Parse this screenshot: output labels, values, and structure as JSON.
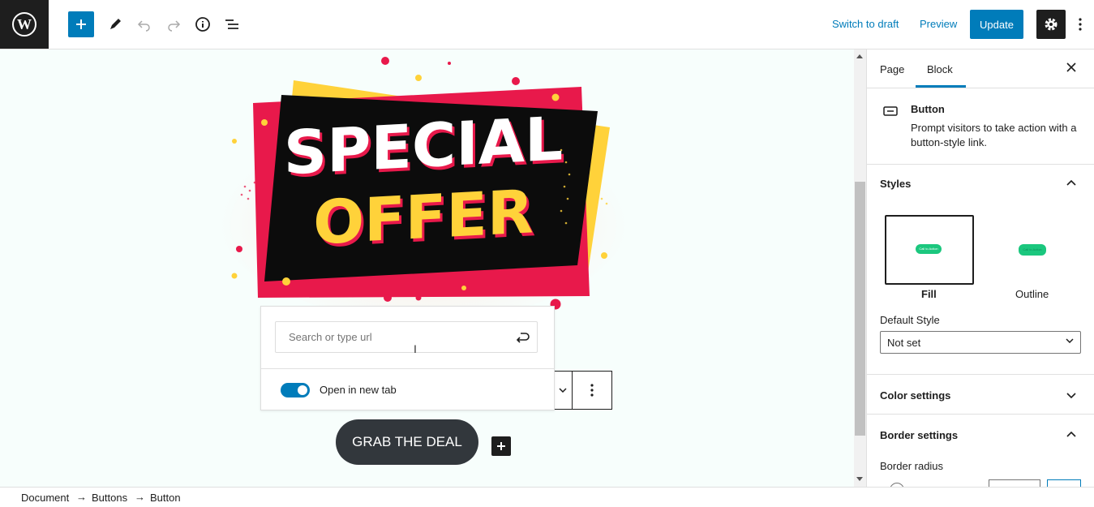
{
  "header": {
    "switch_to_draft": "Switch to draft",
    "preview": "Preview",
    "update": "Update",
    "icons": [
      "wordpress-logo",
      "plus-icon",
      "pencil-icon",
      "undo-icon",
      "redo-icon",
      "info-icon",
      "list-view-icon",
      "gear-icon",
      "more-vertical-icon"
    ]
  },
  "banner": {
    "line1": "SPECIAL",
    "line2": "OFFER"
  },
  "link_popover": {
    "placeholder": "Search or type url",
    "toggle_label": "Open in new tab",
    "toggle_on": true
  },
  "button_block": {
    "label": "GRAB THE DEAL"
  },
  "breadcrumb": {
    "items": [
      "Document",
      "Buttons",
      "Button"
    ],
    "separator": "→"
  },
  "sidebar": {
    "tabs": [
      "Page",
      "Block"
    ],
    "active_tab": "Block",
    "block": {
      "name": "Button",
      "description": "Prompt visitors to take action with a button-style link."
    },
    "styles": {
      "title": "Styles",
      "options": [
        "Fill",
        "Outline"
      ],
      "selected": "Fill",
      "preview_text": "Call to Action",
      "default_style_label": "Default Style",
      "default_style_value": "Not set"
    },
    "color_settings": "Color settings",
    "border_settings": "Border settings",
    "border_radius_label": "Border radius"
  },
  "colors": {
    "accent": "#007cba",
    "dark": "#1e1e1e",
    "button_bg": "#32373c",
    "banner_red": "#e8194b",
    "banner_yellow": "#ffd23a",
    "preview_green": "#1bc77e"
  }
}
